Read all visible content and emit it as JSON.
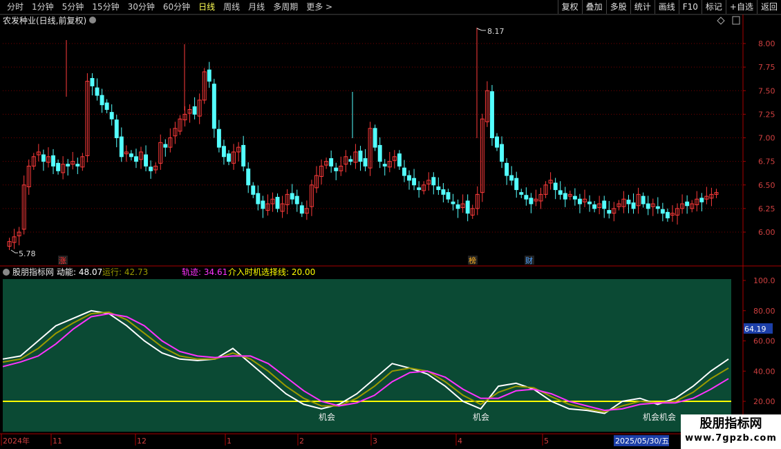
{
  "toolbar": {
    "periods": [
      "分时",
      "1分钟",
      "5分钟",
      "15分钟",
      "30分钟",
      "60分钟",
      "日线",
      "周线",
      "月线",
      "多周期",
      "更多 >"
    ],
    "active_period": "日线",
    "right_buttons": [
      "复权",
      "叠加",
      "多股",
      "统计",
      "画线",
      "F10",
      "标记",
      "+自选",
      "返回"
    ]
  },
  "main_chart": {
    "title": "农发种业(日线,前复权)",
    "high_label": "8.17",
    "low_label": "5.78",
    "y_ticks": [
      "8.00",
      "7.75",
      "7.50",
      "7.25",
      "7.00",
      "6.75",
      "6.50",
      "6.25",
      "6.00"
    ],
    "markers": [
      {
        "text": "涨",
        "color": "#ff3030"
      },
      {
        "text": "榜",
        "color": "#ffb020"
      },
      {
        "text": "财",
        "color": "#4aa0ff"
      }
    ]
  },
  "indicator": {
    "name": "股朋指标网",
    "dongneng_label": "动能:",
    "dongneng_value": "48.07",
    "yunxing_label": "运行:",
    "yunxing_value": "42.73",
    "guiji_label": "轨迹:",
    "guiji_value": "34.61",
    "jieru_label": "介入时机选择线:",
    "jieru_value": "20.00",
    "current_value": "64.19",
    "y_ticks": [
      "100.0",
      "80.00",
      "60.00",
      "40.00",
      "20.00"
    ],
    "signals": [
      "机会",
      "机会",
      "机会机会"
    ]
  },
  "x_axis": {
    "labels": [
      "2024年",
      "11",
      "12",
      "1",
      "2",
      "3",
      "4",
      "5"
    ],
    "cursor_date": "2025/05/30/五"
  },
  "watermark": {
    "title": "股朋指标网",
    "url": "www.7gpzb.com"
  },
  "colors": {
    "up": "#ff3b3b",
    "down": "#54ffff",
    "dongneng": "#ffffff",
    "yunxing": "#9a9a00",
    "guiji": "#ff33ff",
    "jieru": "#ffff00",
    "panel_bg": "#0b4a34"
  },
  "chart_data": {
    "type": "candlestick",
    "ylim": [
      5.78,
      8.17
    ],
    "high": 8.17,
    "low": 5.78,
    "closes": [
      5.9,
      5.95,
      6.0,
      6.5,
      6.7,
      6.8,
      6.85,
      6.75,
      6.8,
      6.7,
      6.65,
      6.72,
      6.7,
      6.75,
      6.7,
      6.8,
      7.6,
      7.55,
      7.45,
      7.35,
      7.3,
      7.2,
      7.0,
      6.8,
      6.85,
      6.8,
      6.75,
      6.85,
      6.7,
      6.65,
      6.7,
      6.95,
      6.9,
      7.0,
      7.1,
      7.2,
      7.25,
      7.3,
      7.25,
      7.4,
      7.7,
      7.6,
      7.1,
      6.9,
      6.8,
      6.75,
      6.85,
      6.9,
      6.7,
      6.5,
      6.4,
      6.3,
      6.25,
      6.3,
      6.35,
      6.25,
      6.3,
      6.4,
      6.35,
      6.3,
      6.2,
      6.25,
      6.5,
      6.6,
      6.7,
      6.75,
      6.7,
      6.65,
      6.7,
      6.8,
      6.75,
      6.85,
      6.75,
      6.7,
      7.1,
      6.9,
      6.75,
      6.7,
      6.75,
      6.8,
      6.7,
      6.6,
      6.55,
      6.5,
      6.45,
      6.5,
      6.55,
      6.5,
      6.45,
      6.4,
      6.35,
      6.3,
      6.25,
      6.3,
      6.2,
      6.25,
      6.4,
      7.2,
      7.5,
      7.0,
      6.9,
      6.75,
      6.6,
      6.55,
      6.45,
      6.4,
      6.35,
      6.3,
      6.35,
      6.4,
      6.5,
      6.55,
      6.45,
      6.4,
      6.35,
      6.4,
      6.35,
      6.3,
      6.35,
      6.3,
      6.25,
      6.3,
      6.25,
      6.2,
      6.25,
      6.3,
      6.35,
      6.3,
      6.25,
      6.4,
      6.3,
      6.25,
      6.3,
      6.25,
      6.2,
      6.15,
      6.2,
      6.25,
      6.3,
      6.28,
      6.3,
      6.35,
      6.32,
      6.38,
      6.4,
      6.42
    ],
    "indicator_series": [
      {
        "name": "动能",
        "values": [
          48,
          50,
          60,
          70,
          75,
          80,
          78,
          70,
          60,
          52,
          48,
          47,
          48,
          55,
          45,
          35,
          25,
          18,
          15,
          18,
          25,
          35,
          45,
          42,
          38,
          30,
          20,
          15,
          30,
          32,
          28,
          20,
          15,
          14,
          12,
          20,
          22,
          18,
          22,
          30,
          40,
          48
        ]
      },
      {
        "name": "运行",
        "values": [
          46,
          48,
          55,
          65,
          72,
          78,
          79,
          74,
          65,
          56,
          50,
          48,
          48,
          52,
          48,
          40,
          30,
          22,
          17,
          17,
          22,
          30,
          40,
          42,
          40,
          33,
          24,
          18,
          26,
          30,
          29,
          23,
          18,
          15,
          13,
          17,
          20,
          19,
          20,
          26,
          35,
          42
        ]
      },
      {
        "name": "轨迹",
        "values": [
          43,
          46,
          50,
          58,
          68,
          76,
          78,
          76,
          70,
          60,
          53,
          50,
          49,
          50,
          50,
          45,
          36,
          27,
          20,
          17,
          19,
          24,
          33,
          39,
          40,
          36,
          28,
          22,
          22,
          27,
          28,
          25,
          20,
          17,
          14,
          15,
          18,
          19,
          19,
          22,
          28,
          35
        ]
      }
    ],
    "threshold": 20
  }
}
